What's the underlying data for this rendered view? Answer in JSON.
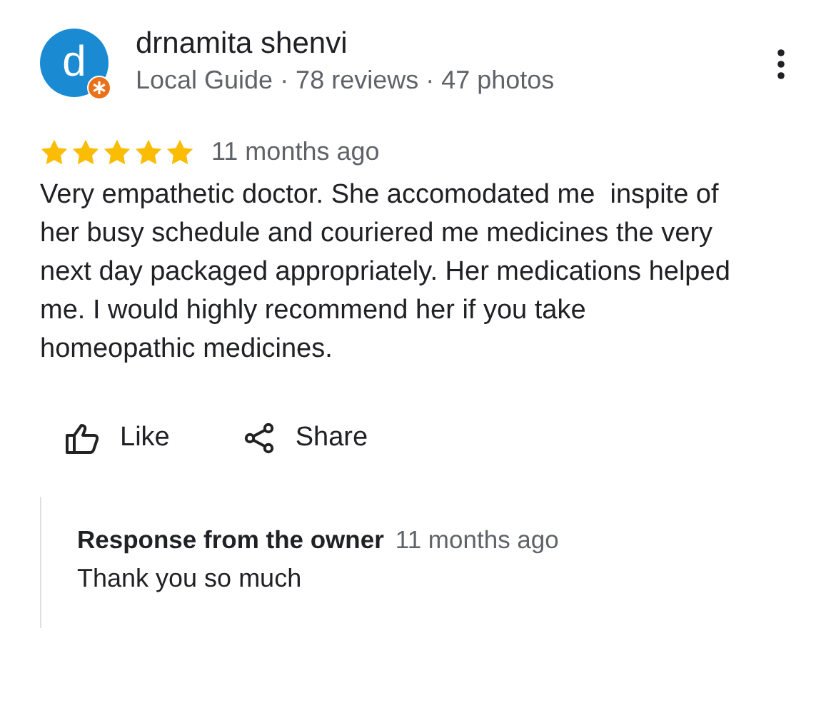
{
  "reviewer": {
    "avatar_letter": "d",
    "name": "drnamita shenvi",
    "meta": "Local Guide · 78 reviews · 47 photos",
    "local_guide": true
  },
  "review": {
    "stars": 5,
    "time": "11 months ago",
    "text": "Very empathetic doctor. She accomodated me  inspite of her busy schedule and couriered me medicines the very next day packaged appropriately. Her medications helped me. I would highly recommend her if you take homeopathic medicines."
  },
  "actions": [
    {
      "kind": "like",
      "label": "Like"
    },
    {
      "kind": "share",
      "label": "Share"
    }
  ],
  "owner_response": {
    "title": "Response from the owner",
    "time": "11 months ago",
    "text": "Thank you so much"
  }
}
